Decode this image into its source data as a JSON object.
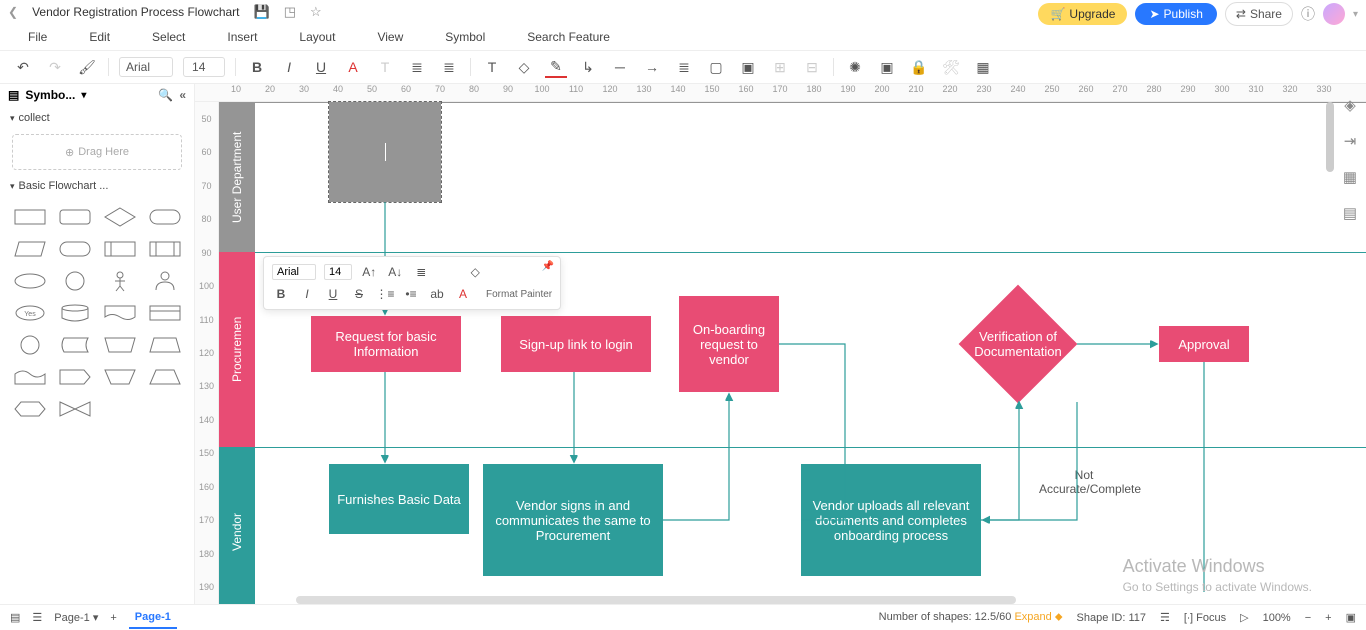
{
  "title": "Vendor Registration Process Flowchart",
  "titlebar_buttons": {
    "upgrade": "Upgrade",
    "publish": "Publish",
    "share": "Share"
  },
  "menu": {
    "file": "File",
    "edit": "Edit",
    "select": "Select",
    "insert": "Insert",
    "layout": "Layout",
    "view": "View",
    "symbol": "Symbol",
    "search": "Search Feature"
  },
  "toolbar": {
    "font": "Arial",
    "size": "14"
  },
  "sidebar": {
    "title": "Symbo...",
    "section_collect": "collect",
    "drag_here": "Drag Here",
    "section_basic": "Basic Flowchart ..."
  },
  "lanes": {
    "user": "User Department",
    "procurement": "Procuremen",
    "vendor": "Vendor"
  },
  "nodes": {
    "req_basic": "Request for basic Information",
    "signup": "Sign-up link to login",
    "onboard_req": "On-boarding request to vendor",
    "verification": "Verification of Documentation",
    "approval": "Approval",
    "furnish": "Furnishes Basic Data",
    "vendor_signs": "Vendor signs in and communicates the same to Procurement",
    "vendor_uploads": "Vendor uploads all relevant documents and completes onboarding process",
    "not_accurate": "Not Accurate/Complete"
  },
  "float_toolbar": {
    "font": "Arial",
    "size": "14",
    "format_painter": "Format Painter"
  },
  "ruler_h": [
    "10",
    "20",
    "30",
    "40",
    "50",
    "60",
    "70",
    "80",
    "90",
    "100",
    "110",
    "120",
    "130",
    "140",
    "150",
    "160",
    "170",
    "180",
    "190",
    "200",
    "210",
    "220",
    "230",
    "240",
    "250",
    "260",
    "270",
    "280",
    "290",
    "300",
    "310",
    "320",
    "330"
  ],
  "ruler_v": [
    "50",
    "60",
    "70",
    "80",
    "90",
    "100",
    "110",
    "120",
    "130",
    "140",
    "150",
    "160",
    "170",
    "180",
    "190"
  ],
  "status": {
    "page_dropdown": "Page-1",
    "page_tab": "Page-1",
    "shapes_label": "Number of shapes: 12.5/60",
    "expand": "Expand",
    "shape_id": "Shape ID: 117",
    "focus": "Focus",
    "zoom": "100%"
  },
  "watermark": {
    "line1": "Activate Windows",
    "line2": "Go to Settings to activate Windows."
  }
}
